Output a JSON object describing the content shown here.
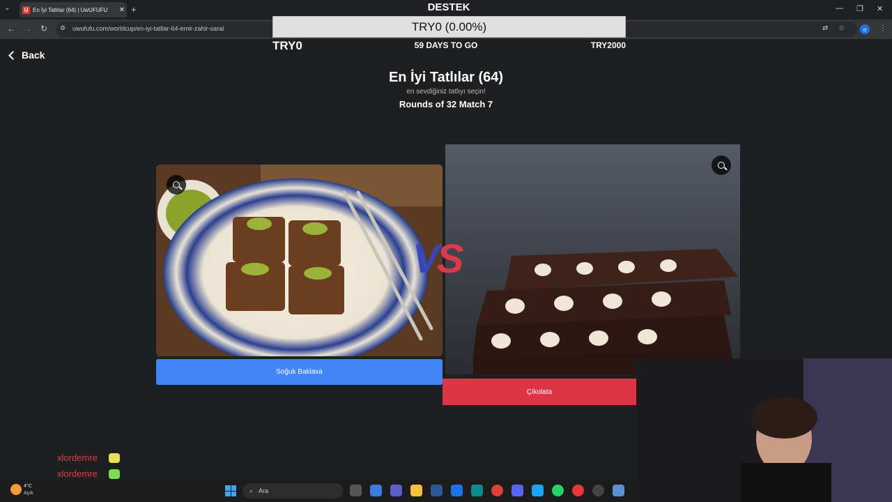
{
  "browser": {
    "tab_title": "En İyi Tatlılar (64) | UwUFUFU",
    "tab_favicon": "U",
    "url": "uwufufu.com/worldcup/en-iyi-tatllar-64-emir-zahir-saral"
  },
  "donation": {
    "heading": "DESTEK",
    "progress_text": "TRY0 (0.00%)",
    "progress_fraction": 0,
    "current": "TRY0",
    "days_left": "59 DAYS TO GO",
    "goal": "TRY2000"
  },
  "page": {
    "back_label": "Back",
    "title": "En İyi Tatlılar (64)",
    "subtitle": "en sevdiğiniz tatlıyı seçin!",
    "round": "Rounds of 32 Match 7",
    "vs_v": "V",
    "vs_s": "S",
    "left_choice": "Soğuk Baklava",
    "right_choice": "Çikolata"
  },
  "chat": {
    "messages": [
      {
        "user": "xlordemre",
        "emote_color": "#e8e25a"
      },
      {
        "user": "xlordemre",
        "emote_color": "#7ed957"
      },
      {
        "user": "xlordemre",
        "emote_color": "#d9d9d9"
      }
    ]
  },
  "taskbar": {
    "temperature": "4°C",
    "condition": "Açık",
    "search_placeholder": "Ara"
  },
  "colors": {
    "left_button": "#4285f4",
    "right_button": "#dc3545",
    "chat_name": "#e53945"
  }
}
